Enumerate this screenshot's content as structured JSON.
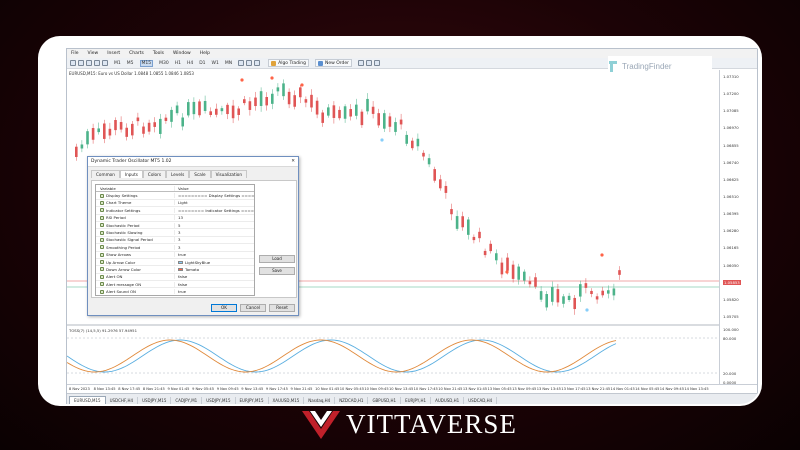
{
  "app": {
    "menu": [
      "File",
      "View",
      "Insert",
      "Charts",
      "Tools",
      "Window",
      "Help"
    ],
    "timeframes": [
      "M1",
      "M5",
      "M15",
      "M30",
      "H1",
      "H4",
      "D1",
      "W1",
      "MN"
    ],
    "active_timeframe": "M15",
    "algo_trading_label": "Algo Trading",
    "new_order_label": "New Order"
  },
  "chart": {
    "symbol_label": "EURUSD,M15: Euro vs US Dollar  1.0848  1.0855  1.0846  1.0853",
    "oscillator_label": "TOSS(7) (14,5,5) 91.2976 57.94951",
    "price_ticks": [
      "1.07310",
      "1.07200",
      "1.07085",
      "1.06970",
      "1.06855",
      "1.06740",
      "1.06625",
      "1.06510",
      "1.06395",
      "1.06280",
      "1.06165",
      "1.06050",
      "1.05935",
      "1.05820",
      "1.05705"
    ],
    "current_price": "1.05853",
    "osc_ticks": [
      "100.000",
      "80.000",
      "20.000",
      "0.0000"
    ],
    "time_ticks": [
      "8 Nov 2023",
      "8 Nov 13:45",
      "8 Nov 17:45",
      "8 Nov 21:45",
      "9 Nov 01:45",
      "9 Nov 05:45",
      "9 Nov 09:45",
      "9 Nov 13:45",
      "9 Nov 17:45",
      "9 Nov 21:45",
      "10 Nov 01:45",
      "10 Nov 05:45",
      "10 Nov 09:45",
      "10 Nov 13:45",
      "10 Nov 17:45",
      "10 Nov 21:45",
      "13 Nov 01:45",
      "13 Nov 05:45",
      "13 Nov 09:45",
      "13 Nov 13:45",
      "13 Nov 17:45",
      "13 Nov 21:45",
      "14 Nov 01:45",
      "14 Nov 05:45",
      "14 Nov 09:45",
      "14 Nov 13:45"
    ],
    "bull_color": "#4cb38a",
    "bear_color": "#e05555",
    "osc_line1_color": "#e08a3c",
    "osc_line2_color": "#5aaee0"
  },
  "tabs": [
    "EURUSD,M15",
    "USDCHF,H4",
    "USDJPY,M15",
    "CADJPY,M1",
    "USDJPY,M15",
    "EURJPY,M15",
    "XAUUSD,M15",
    "Nasdaq,H4",
    "NZDCAD,H1",
    "GBPUSD,H1",
    "EURJPY,H1",
    "AUDUSD,H1",
    "USDCAD,H4"
  ],
  "active_tab": "EURUSD,M15",
  "dialog": {
    "title": "Dynamic Trader Oscillator MT5 1.02",
    "tabs": [
      "Common",
      "Inputs",
      "Colors",
      "Levels",
      "Scale",
      "Visualization"
    ],
    "active_tab": "Inputs",
    "columns": [
      "Variable",
      "Value"
    ],
    "rows": [
      {
        "name": "Display Settings",
        "value": "========= Display Settings =========",
        "icon": "ab"
      },
      {
        "name": "Chart Theme",
        "value": "Light",
        "icon": "enum"
      },
      {
        "name": "Indicator Settings",
        "value": "======== Indicator Settings ========",
        "icon": "ab"
      },
      {
        "name": "RSI Period",
        "value": "13",
        "icon": "123"
      },
      {
        "name": "Stochastic Period",
        "value": "5",
        "icon": "123"
      },
      {
        "name": "Stochastic Slowing",
        "value": "3",
        "icon": "123"
      },
      {
        "name": "Stochastic Signal Period",
        "value": "3",
        "icon": "123"
      },
      {
        "name": "Smoothing Period",
        "value": "3",
        "icon": "123"
      },
      {
        "name": "Show Arrows",
        "value": "true",
        "icon": "bool"
      },
      {
        "name": "Up Arrow Color",
        "value": "LightSkyBlue",
        "icon": "color",
        "swatch": "#87cefa"
      },
      {
        "name": "Down Arrow Color",
        "value": "Tomato",
        "icon": "color",
        "swatch": "#ff6347"
      },
      {
        "name": "Alert ON",
        "value": "false",
        "icon": "bool"
      },
      {
        "name": "Alert message ON",
        "value": "false",
        "icon": "bool"
      },
      {
        "name": "Alert Sound ON",
        "value": "true",
        "icon": "bool"
      },
      {
        "name": "Alert Email ON",
        "value": "false",
        "icon": "bool"
      }
    ],
    "load_label": "Load",
    "save_label": "Save",
    "ok_label": "OK",
    "cancel_label": "Cancel",
    "reset_label": "Reset"
  },
  "overlay": {
    "logo_text": "TradingFinder",
    "brand_text": "VITTAVERSE",
    "accent_color": "#c0202a"
  }
}
